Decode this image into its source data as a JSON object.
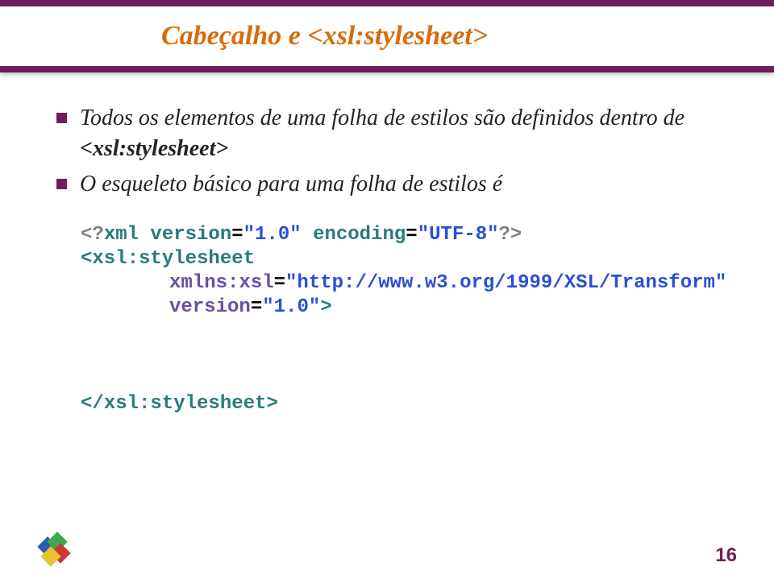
{
  "title": "Cabeçalho e <xsl:stylesheet>",
  "bullets": [
    {
      "prefix": "Todos os elementos de uma folha de estilos são definidos dentro de ",
      "bold": "<xsl:stylesheet>"
    },
    {
      "prefix": "O esqueleto básico para uma folha de estilos é",
      "bold": ""
    }
  ],
  "code": {
    "line1_a": "<?",
    "line1_b": "xml version",
    "line1_c": "=",
    "line1_d": "\"1.0\"",
    "line1_e": " encoding",
    "line1_f": "=",
    "line1_g": "\"UTF-8\"",
    "line1_h": "?>",
    "line2_a": "<",
    "line2_b": "xsl:stylesheet",
    "line3_a": "xmlns:xsl",
    "line3_b": "=",
    "line3_c": "\"http://www.w3.org/1999/XSL/Transform\"",
    "line4_a": "version",
    "line4_b": "=",
    "line4_c": "\"1.0\"",
    "line4_d": ">",
    "line5_a": "</",
    "line5_b": "xsl:stylesheet",
    "line5_c": ">"
  },
  "page_number": "16",
  "logo_colors": {
    "blue": "#2a5fb0",
    "green": "#3ea84a",
    "red": "#c83a3a",
    "yellow": "#e6c22e"
  }
}
